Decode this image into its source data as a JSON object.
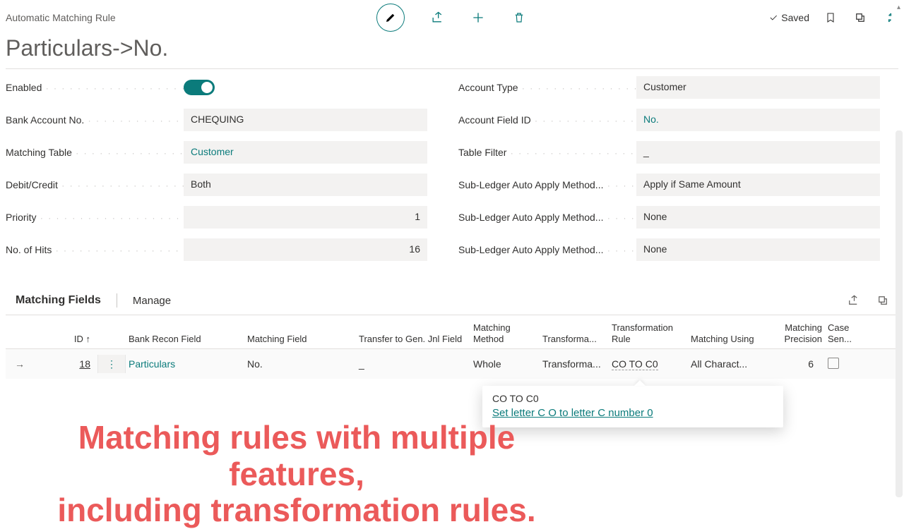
{
  "header": {
    "breadcrumb": "Automatic Matching Rule",
    "saved_label": "Saved"
  },
  "title": "Particulars->No.",
  "fields_left": {
    "enabled": {
      "label": "Enabled"
    },
    "bank_acct": {
      "label": "Bank Account No.",
      "value": "CHEQUING"
    },
    "matching_table": {
      "label": "Matching Table",
      "value": "Customer"
    },
    "debit_credit": {
      "label": "Debit/Credit",
      "value": "Both"
    },
    "priority": {
      "label": "Priority",
      "value": "1"
    },
    "hits": {
      "label": "No. of Hits",
      "value": "16"
    }
  },
  "fields_right": {
    "acct_type": {
      "label": "Account Type",
      "value": "Customer"
    },
    "acct_field_id": {
      "label": "Account Field ID",
      "value": "No."
    },
    "table_filter": {
      "label": "Table Filter",
      "value": "_"
    },
    "sub1": {
      "label": "Sub-Ledger Auto Apply Method...",
      "value": "Apply if Same Amount"
    },
    "sub2": {
      "label": "Sub-Ledger Auto Apply Method...",
      "value": "None"
    },
    "sub3": {
      "label": "Sub-Ledger Auto Apply Method...",
      "value": "None"
    }
  },
  "grid": {
    "section_title": "Matching Fields",
    "manage_label": "Manage",
    "columns": {
      "id": "ID ↑",
      "bank_recon": "Bank Recon Field",
      "matching_field": "Matching Field",
      "transfer": "Transfer to Gen. Jnl Field",
      "method": "Matching Method",
      "transforma": "Transforma...",
      "rule": "Transformation Rule",
      "using": "Matching Using",
      "precision": "Matching Precision",
      "case": "Case Sen..."
    },
    "row": {
      "id": "18",
      "bank_recon": "Particulars",
      "matching_field": "No.",
      "transfer": "_",
      "method": "Whole",
      "transforma": "Transforma...",
      "rule": "CO TO C0",
      "using": "All Charact...",
      "precision": "6"
    }
  },
  "tooltip": {
    "title": "CO TO C0",
    "link": "Set letter C O to letter C number 0"
  },
  "annotation": {
    "line1": "Matching rules with multiple features,",
    "line2": "including transformation rules."
  }
}
